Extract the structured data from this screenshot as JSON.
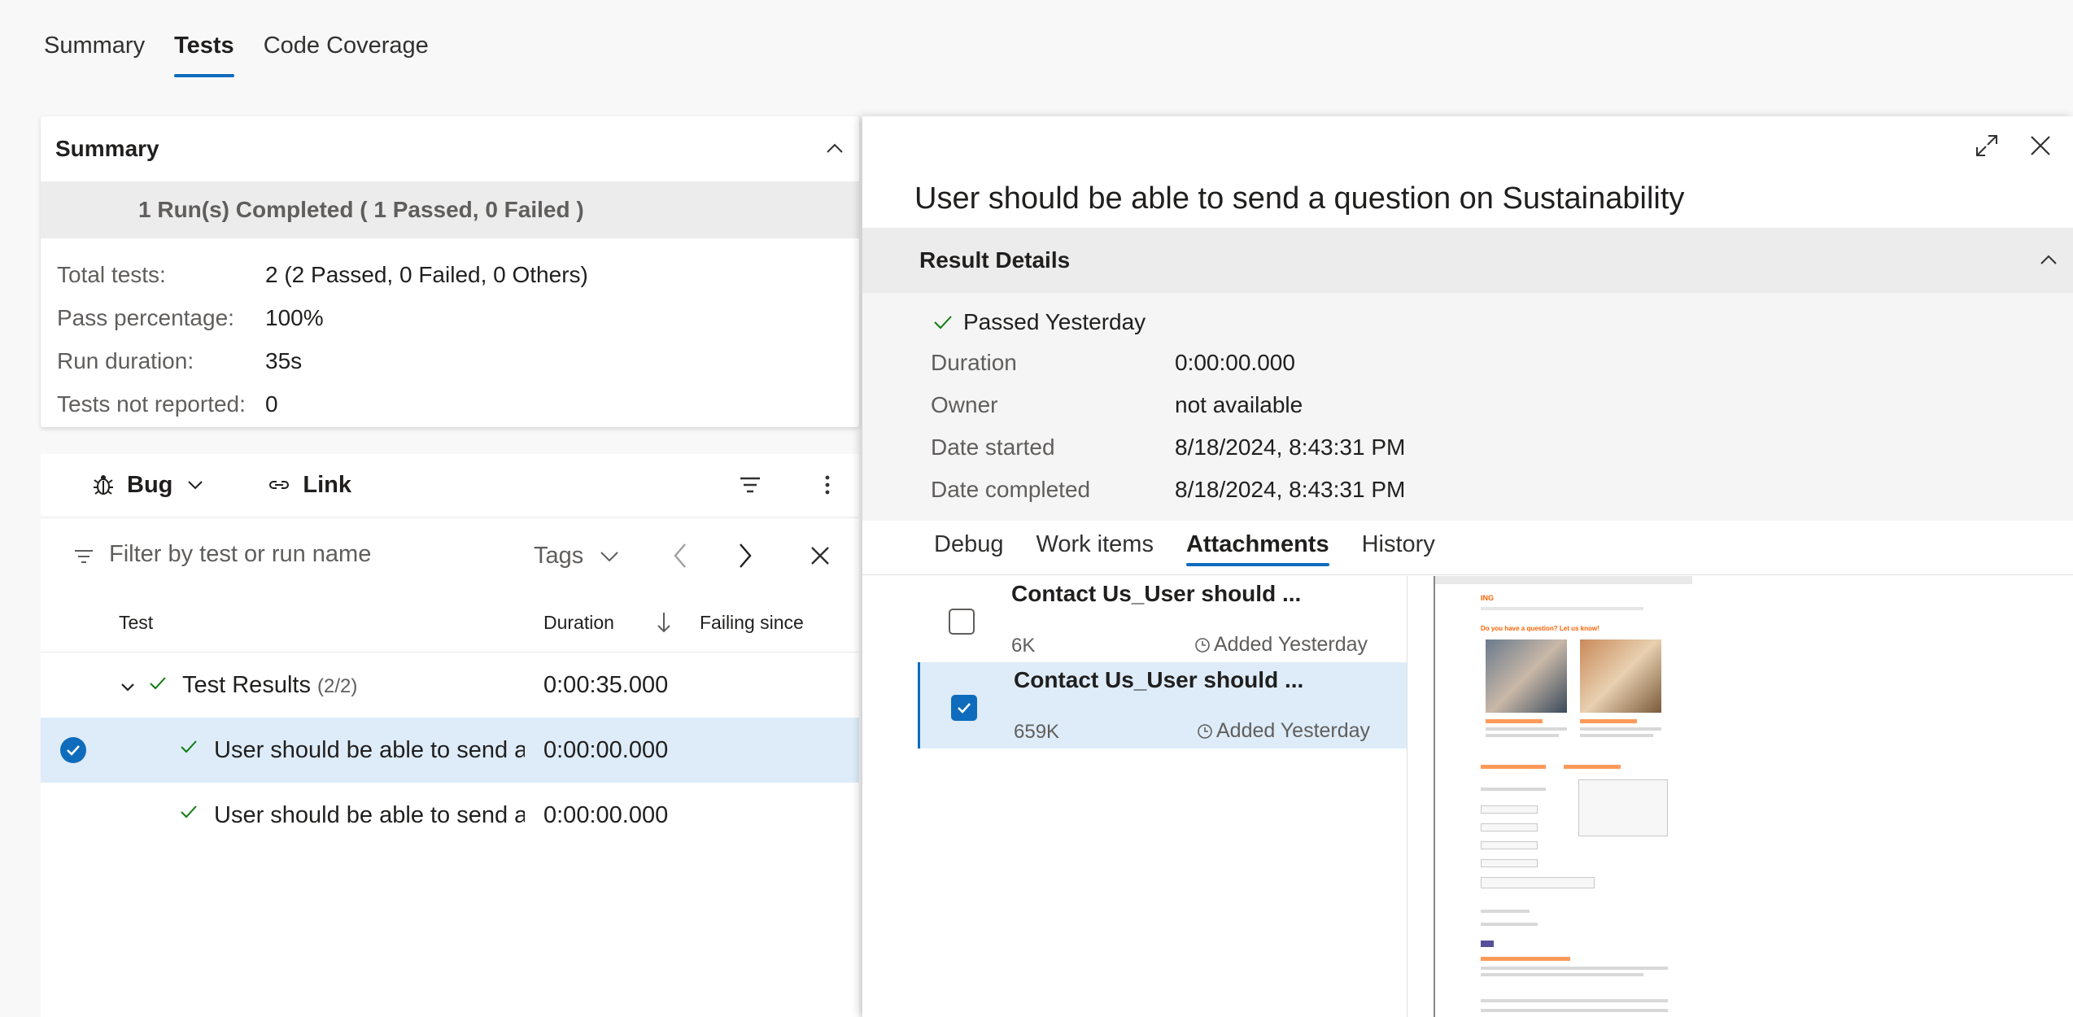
{
  "top_tabs": [
    {
      "label": "Summary"
    },
    {
      "label": "Tests"
    },
    {
      "label": "Code Coverage"
    }
  ],
  "summary": {
    "title": "Summary",
    "run_status": "1 Run(s) Completed ( 1 Passed, 0 Failed )",
    "stats": [
      {
        "label": "Total tests:",
        "value": "2 (2 Passed, 0 Failed, 0 Others)"
      },
      {
        "label": "Pass percentage:",
        "value": "100%"
      },
      {
        "label": "Run duration:",
        "value": "35s"
      },
      {
        "label": "Tests not reported:",
        "value": "0"
      }
    ]
  },
  "toolbar": {
    "bug_label": "Bug",
    "link_label": "Link"
  },
  "filter": {
    "placeholder": "Filter by test or run name",
    "tags_label": "Tags"
  },
  "table": {
    "headers": {
      "test": "Test",
      "duration": "Duration",
      "failing_since": "Failing since"
    },
    "group": {
      "name": "Test Results",
      "count": "(2/2)",
      "duration": "0:00:35.000"
    },
    "rows": [
      {
        "name": "User should be able to send a question on Sustainability",
        "duration": "0:00:00.000"
      },
      {
        "name": "User should be able to send a question on Sustainability",
        "duration": "0:00:00.000"
      }
    ]
  },
  "panel": {
    "title": "User should be able to send a question on Sustainability",
    "result_details": {
      "heading": "Result Details",
      "outcome": "Passed Yesterday",
      "rows": [
        {
          "label": "Duration",
          "value": "0:00:00.000"
        },
        {
          "label": "Owner",
          "value": "not available"
        },
        {
          "label": "Date started",
          "value": "8/18/2024, 8:43:31 PM"
        },
        {
          "label": "Date completed",
          "value": "8/18/2024, 8:43:31 PM"
        }
      ]
    },
    "tabs": [
      {
        "label": "Debug"
      },
      {
        "label": "Work items"
      },
      {
        "label": "Attachments"
      },
      {
        "label": "History"
      }
    ],
    "attachments": [
      {
        "name": "Contact Us_User should ...",
        "size": "6K",
        "added": "Added Yesterday",
        "checked": false
      },
      {
        "name": "Contact Us_User should ...",
        "size": "659K",
        "added": "Added Yesterday",
        "checked": true
      }
    ],
    "preview": {
      "logo": "ING",
      "heading": "Do you have a question? Let us know!"
    }
  },
  "colors": {
    "accent": "#0f6cbd",
    "selected_row": "#deecf9",
    "success": "#107c10"
  }
}
